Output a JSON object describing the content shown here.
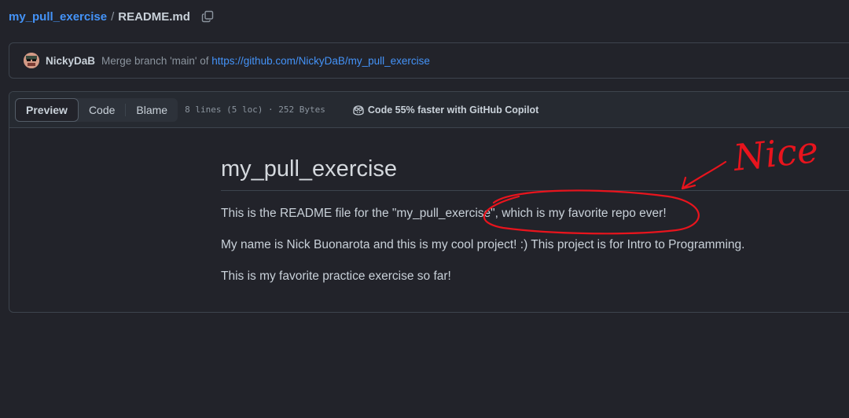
{
  "breadcrumb": {
    "repo": "my_pull_exercise",
    "separator": "/",
    "file": "README.md"
  },
  "commit": {
    "author": "NickyDaB",
    "message": "Merge branch 'main' of",
    "link": "https://github.com/NickyDaB/my_pull_exercise"
  },
  "file_header": {
    "tabs": [
      "Preview",
      "Code",
      "Blame"
    ],
    "active_tab": "Preview",
    "meta": "8 lines (5 loc) · 252 Bytes",
    "copilot": "Code 55% faster with GitHub Copilot"
  },
  "readme": {
    "title": "my_pull_exercise",
    "paragraphs": [
      "This is the README file for the \"my_pull_exercise\", which is my favorite repo ever!",
      "My name is Nick Buonarota and this is my cool project! :) This project is for Intro to Programming.",
      "This is my favorite practice exercise so far!"
    ]
  },
  "annotation": {
    "text": "Nice",
    "color": "#e8141d"
  },
  "colors": {
    "background": "#22232a",
    "link": "#4493f8",
    "border": "#3d444d",
    "annotation": "#e8141d"
  }
}
